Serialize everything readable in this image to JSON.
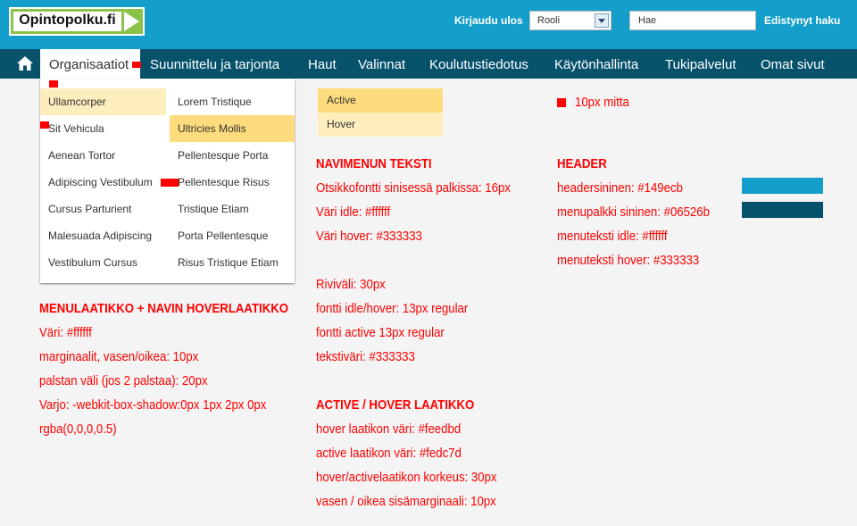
{
  "header": {
    "logo_text": "Opintopolku.fi",
    "login_link": "Kirjaudu ulos",
    "role_value": "Rooli",
    "search_placeholder": "Hae",
    "advanced_search": "Edistynyt haku"
  },
  "nav": {
    "items": [
      {
        "label": "Organisaatiot",
        "state": "active"
      },
      {
        "label": "Suunnittelu ja tarjonta"
      },
      {
        "label": "Haut"
      },
      {
        "label": "Valinnat"
      },
      {
        "label": "Koulutustiedotus"
      },
      {
        "label": "Käytönhallinta"
      },
      {
        "label": "Tukipalvelut"
      },
      {
        "label": "Omat sivut"
      }
    ]
  },
  "dropdown": {
    "col1": [
      {
        "label": "Ullamcorper",
        "state": "hover"
      },
      {
        "label": "Sit Vehicula"
      },
      {
        "label": "Aenean Tortor"
      },
      {
        "label": "Adipiscing Vestibulum"
      },
      {
        "label": "Cursus Parturient"
      },
      {
        "label": "Malesuada Adipiscing"
      },
      {
        "label": "Vestibulum Cursus"
      }
    ],
    "col2": [
      {
        "label": "Lorem Tristique"
      },
      {
        "label": "Ultricies Mollis",
        "state": "active"
      },
      {
        "label": "Pellentesque Porta"
      },
      {
        "label": "Pellentesque Risus"
      },
      {
        "label": "Tristique Etiam"
      },
      {
        "label": "Porta Pellentesque"
      },
      {
        "label": "Risus Tristique Etiam"
      }
    ]
  },
  "state_samples": {
    "active": "Active",
    "hover": "Hover"
  },
  "legend": {
    "marker_label": "10px mitta"
  },
  "specs": {
    "menu_box": {
      "heading": "MENULAATIKKO + NAVIN HOVERLAATIKKO",
      "lines": [
        "Väri: #ffffff",
        "marginaalit, vasen/oikea: 10px",
        "palstan väli (jos 2 palstaa): 20px",
        "Varjo: -webkit-box-shadow:0px 1px 2px 0px",
        "rgba(0,0,0,0.5)"
      ]
    },
    "nav_text": {
      "heading": "NAVIMENUN TEKSTI",
      "lines": [
        "Otsikkofontti sinisessä palkissa: 16px",
        "Väri idle: #ffffff",
        "Väri hover: #333333",
        "",
        "Riviväli: 30px",
        "fontti idle/hover: 13px regular",
        "fontti active 13px regular",
        "tekstiväri: #333333"
      ]
    },
    "active_hover": {
      "heading": "ACTIVE / HOVER LAATIKKO",
      "lines": [
        "hover laatikon väri: #feedbd",
        "active laatikon väri: #fedc7d",
        "hover/activelaatikon korkeus: 30px",
        "vasen / oikea sisämarginaali: 10px"
      ]
    },
    "header": {
      "heading": "HEADER",
      "lines": [
        "headersininen: #149ecb",
        "menupalkki sininen: #06526b",
        "menuteksti idle: #ffffff",
        "menuteksti hover: #333333"
      ]
    }
  },
  "colors": {
    "header_blue": "#149ecb",
    "menubar_blue": "#06526b",
    "active_box": "#fedc7d",
    "hover_box": "#feedbd",
    "annotation_red": "#ff0000"
  }
}
